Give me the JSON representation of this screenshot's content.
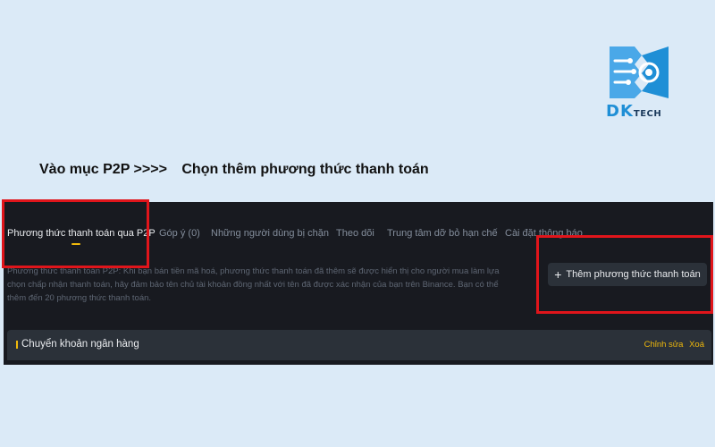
{
  "logo": {
    "text_dk": "DK",
    "text_tech": "TECH",
    "colors": {
      "primary": "#1f8fd6",
      "dark": "#1b3a5c"
    }
  },
  "instruction": {
    "step1": "Vào mục P2P >>>>",
    "step2": "Chọn thêm phương thức thanh toán"
  },
  "tabs": [
    {
      "label": "Phương thức thanh toán qua P2P",
      "active": true
    },
    {
      "label": "Góp ý (0)"
    },
    {
      "label": "Những người dùng bị chặn"
    },
    {
      "label": "Theo dõi"
    },
    {
      "label": "Trung tâm dỡ bỏ hạn chế"
    },
    {
      "label": "Cài đặt thông báo"
    }
  ],
  "description": "Phương thức thanh toán P2P: Khi bạn bán tiền mã hoá, phương thức thanh toán đã thêm sẽ được hiển thị cho người mua làm lựa chọn chấp nhận thanh toán, hãy đảm bảo tên chủ tài khoản đồng nhất với tên đã được xác nhận của bạn trên Binance. Bạn có thể thêm đến 20 phương thức thanh toán.",
  "add_button": {
    "label": "Thêm phương thức thanh toán",
    "icon": "plus-icon"
  },
  "bank_row": {
    "title": "Chuyển khoản ngân hàng",
    "edit_label": "Chỉnh sửa",
    "delete_label": "Xoá"
  },
  "colors": {
    "background": "#dbeaf7",
    "panel": "#181a20",
    "accent": "#f0b90b",
    "highlight": "#e0151b"
  }
}
